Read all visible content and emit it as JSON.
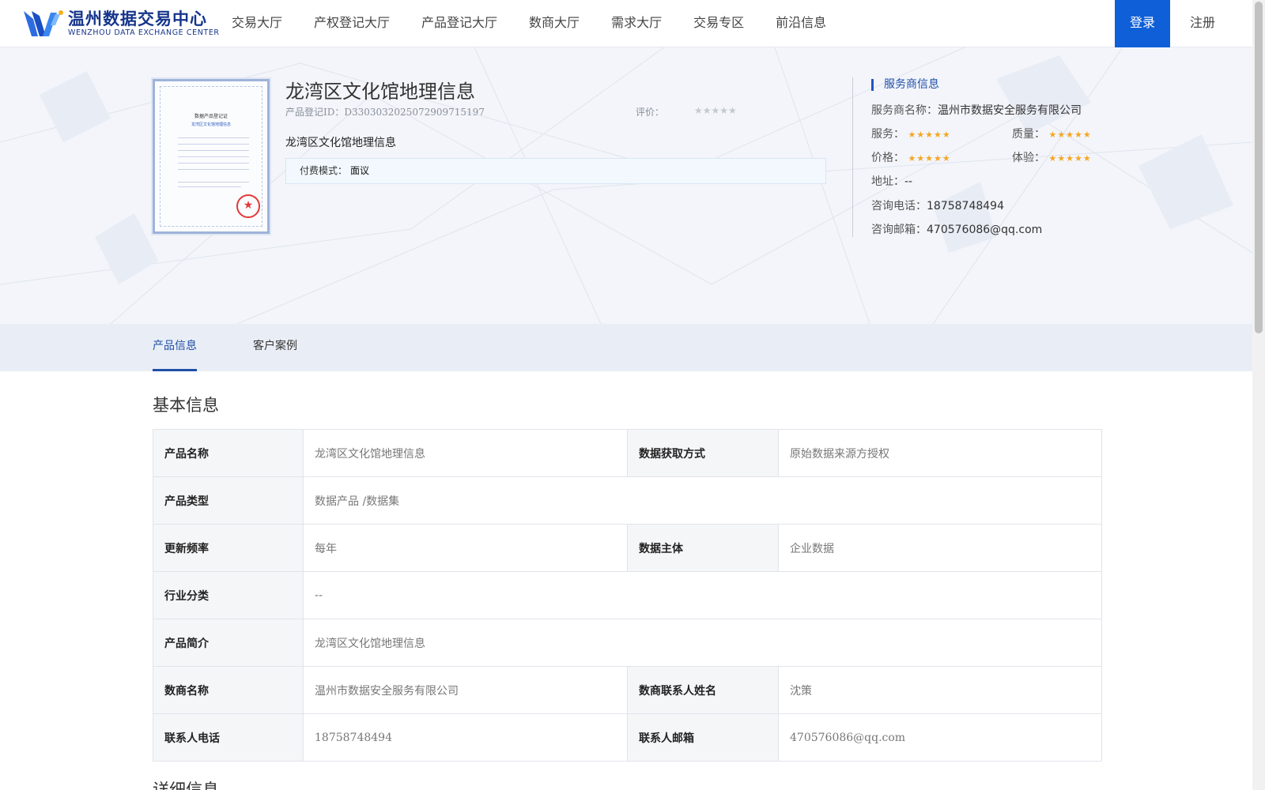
{
  "header": {
    "logo_cn": "温州数据交易中心",
    "logo_en": "WENZHOU DATA EXCHANGE CENTER",
    "nav": [
      "交易大厅",
      "产权登记大厅",
      "产品登记大厅",
      "数商大厅",
      "需求大厅",
      "交易专区",
      "前沿信息"
    ],
    "login": "登录",
    "register": "注册",
    "brand_color": "#0f60d8"
  },
  "product": {
    "title": "龙湾区文化馆地理信息",
    "id_text": "产品登记ID：D33030320250729097151​97",
    "rating_label": "评价：",
    "rating_value": 0,
    "description": "龙湾区文化馆地理信息",
    "fee_label": "付费模式：",
    "fee_value": "面议",
    "certificate": {
      "title": "数据产品登记证",
      "subtitle": "龙湾区文化馆地理信息"
    }
  },
  "provider": {
    "header": "服务商信息",
    "name_label": "服务商名称：",
    "name": "温州市数据安全服务有限公司",
    "service_label": "服务：",
    "service_rating": 5,
    "quality_label": "质量：",
    "quality_rating": 5,
    "price_label": "价格：",
    "price_rating": 5,
    "experience_label": "体验：",
    "experience_rating": 5,
    "address_label": "地址：",
    "address": "--",
    "phone_label": "咨询电话：",
    "phone": "18758748494",
    "email_label": "咨询邮箱：",
    "email": "470576086@qq.com"
  },
  "tabs": [
    {
      "label": "产品信息",
      "active": true
    },
    {
      "label": "客户案例",
      "active": false
    }
  ],
  "basic_info": {
    "title": "基本信息",
    "rows": [
      {
        "k1": "产品名称",
        "v1": "龙湾区文化馆地理信息",
        "k2": "数据获取方式",
        "v2": "原始数据来源方授权"
      },
      {
        "k1": "产品类型",
        "v1": "数据产品 /数据集"
      },
      {
        "k1": "更新频率",
        "v1": "每年",
        "k2": "数据主体",
        "v2": "企业数据"
      },
      {
        "k1": "行业分类",
        "v1": "--"
      },
      {
        "k1": "产品简介",
        "v1": "龙湾区文化馆地理信息"
      },
      {
        "k1": "数商名称",
        "v1": "温州市数据安全服务有限公司",
        "k2": "数商联系人姓名",
        "v2": "沈策"
      },
      {
        "k1": "联系人电话",
        "v1": "18758748494",
        "k2": "联系人邮箱",
        "v2": "470576086@qq.com"
      }
    ]
  },
  "detail_info": {
    "title": "详细信息"
  }
}
